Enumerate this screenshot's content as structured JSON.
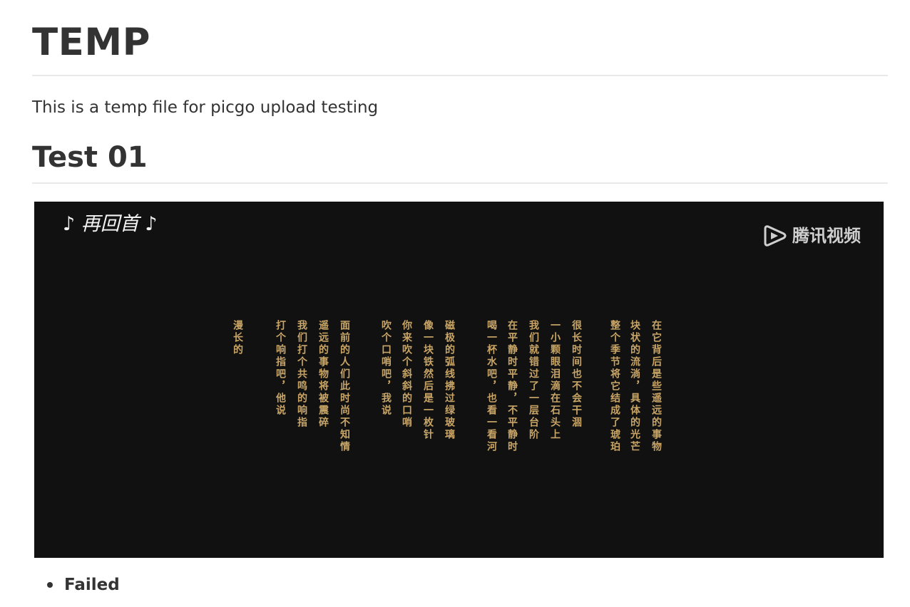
{
  "doc": {
    "title": "TEMP",
    "intro": "This is a temp file for picgo upload testing",
    "section_heading": "Test 01",
    "list_items": [
      "Failed"
    ]
  },
  "video": {
    "song_title": "♪ 再回首 ♪",
    "watermark_text": "腾讯视频",
    "watermark_icon": "tencent-video-logo-icon",
    "lyrics": [
      "在它背后是些遥远的事物",
      "块状的流淌，具体的光芒",
      "整个季节将它结成了琥珀",
      "很长时间也不会干涸",
      "一小颗眼泪滴在石头上",
      "我们就错过了一层台阶",
      "在平静时平静，不平静时",
      "喝一杯水吧，也看一看河",
      "磁极的弧线拂过绿玻璃",
      "像一块铁然后是一枚针",
      "你来吹个斜斜的口哨",
      "吹个口哨吧，我说",
      "面前的人们此时尚不知情",
      "遥远的事物将被震碎",
      "我们打个共鸣的响指",
      "打个响指吧，他说",
      "漫长的"
    ]
  },
  "colors": {
    "text": "#333333",
    "video_bg": "#111111",
    "lyric_gold": "#c8a566",
    "rule": "#e9e9e9"
  }
}
